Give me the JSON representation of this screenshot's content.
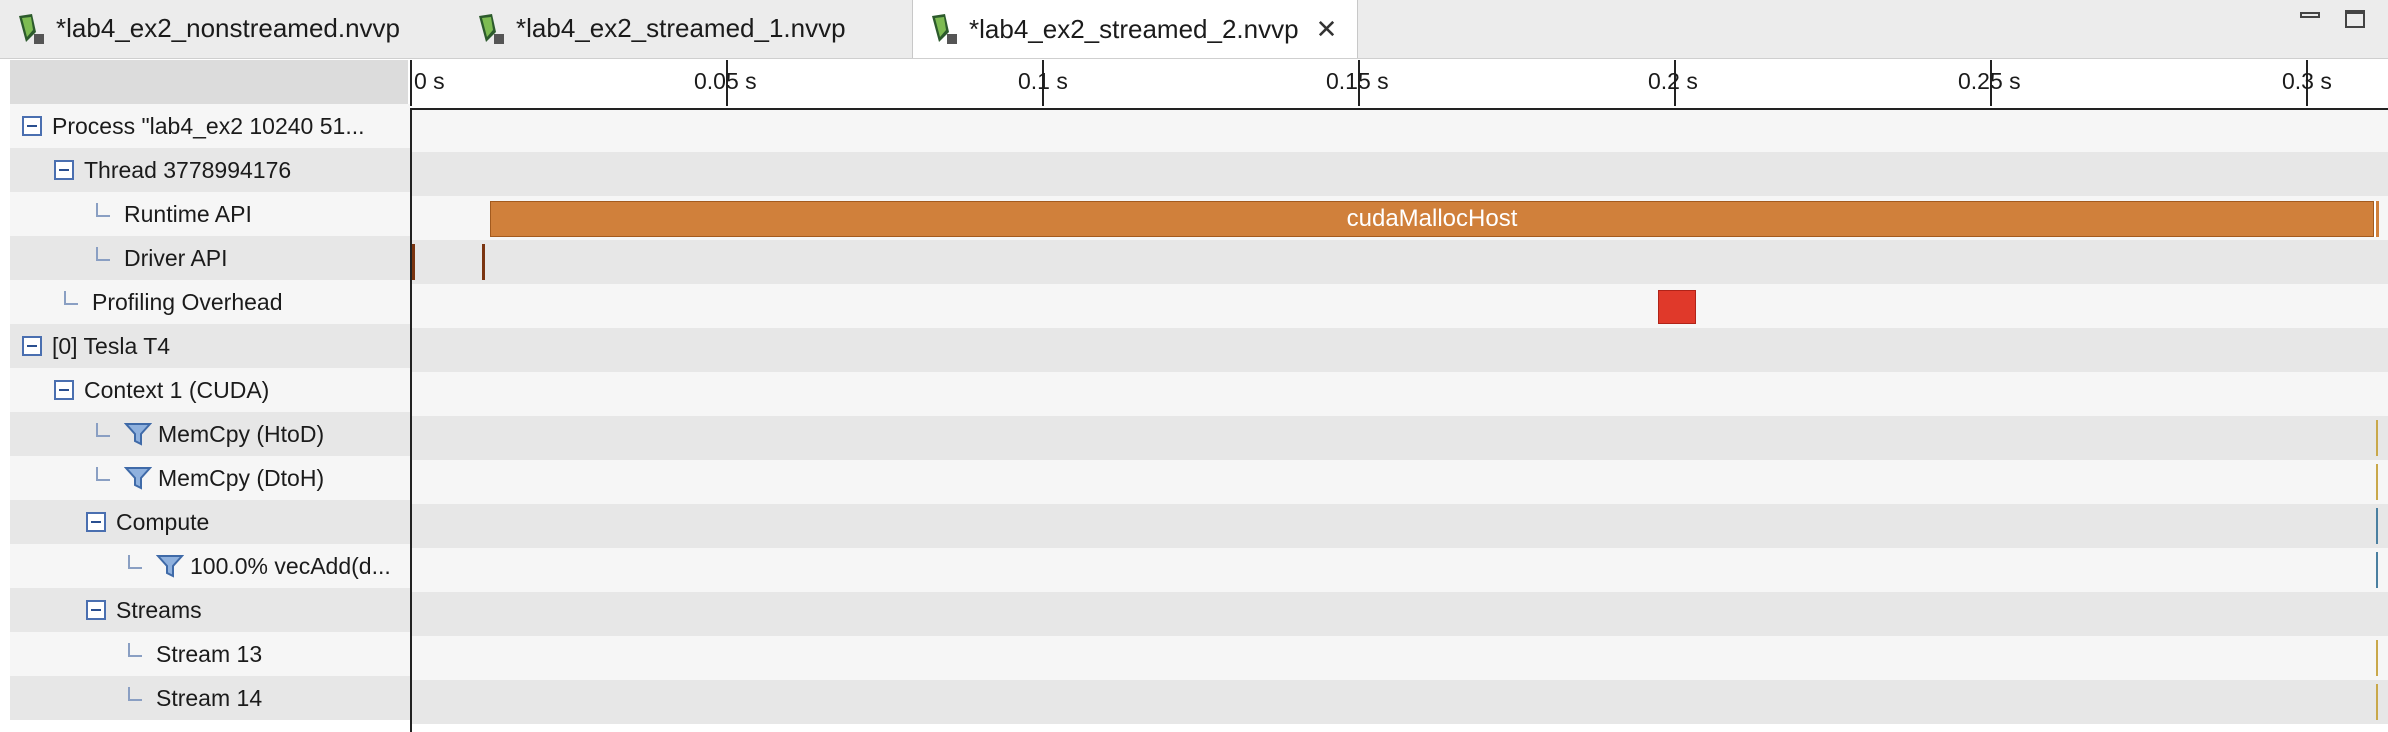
{
  "tabs": [
    {
      "label": "*lab4_ex2_nonstreamed.nvvp",
      "active": false
    },
    {
      "label": "*lab4_ex2_streamed_1.nvvp",
      "active": false
    },
    {
      "label": "*lab4_ex2_streamed_2.nvvp",
      "active": true,
      "close_icon": "close-icon"
    }
  ],
  "tree": {
    "rows": [
      {
        "label": "Process \"lab4_ex2 10240 51...",
        "control": "collapse"
      },
      {
        "label": "Thread 3778994176",
        "control": "collapse"
      },
      {
        "label": "Runtime API",
        "control": "leaf"
      },
      {
        "label": "Driver API",
        "control": "leaf"
      },
      {
        "label": "Profiling Overhead",
        "control": "leaf"
      },
      {
        "label": "[0] Tesla T4",
        "control": "collapse"
      },
      {
        "label": "Context 1 (CUDA)",
        "control": "collapse"
      },
      {
        "label": "MemCpy (HtoD)",
        "control": "leaf-filter"
      },
      {
        "label": "MemCpy (DtoH)",
        "control": "leaf-filter"
      },
      {
        "label": "Compute",
        "control": "collapse"
      },
      {
        "label": "100.0% vecAdd(d...",
        "control": "leaf-filter"
      },
      {
        "label": "Streams",
        "control": "collapse"
      },
      {
        "label": "Stream 13",
        "control": "leaf"
      },
      {
        "label": "Stream 14",
        "control": "leaf"
      }
    ]
  },
  "timeline": {
    "ticks": [
      "0 s",
      "0.05 s",
      "0.1 s",
      "0.15 s",
      "0.2 s",
      "0.25 s",
      "0.3 s"
    ],
    "runtime_bar_label": "cudaMallocHost"
  },
  "colors": {
    "runtime_bar": "#d0803b",
    "overhead": "#e0392a",
    "accent_tree": "#4a6fb0"
  }
}
